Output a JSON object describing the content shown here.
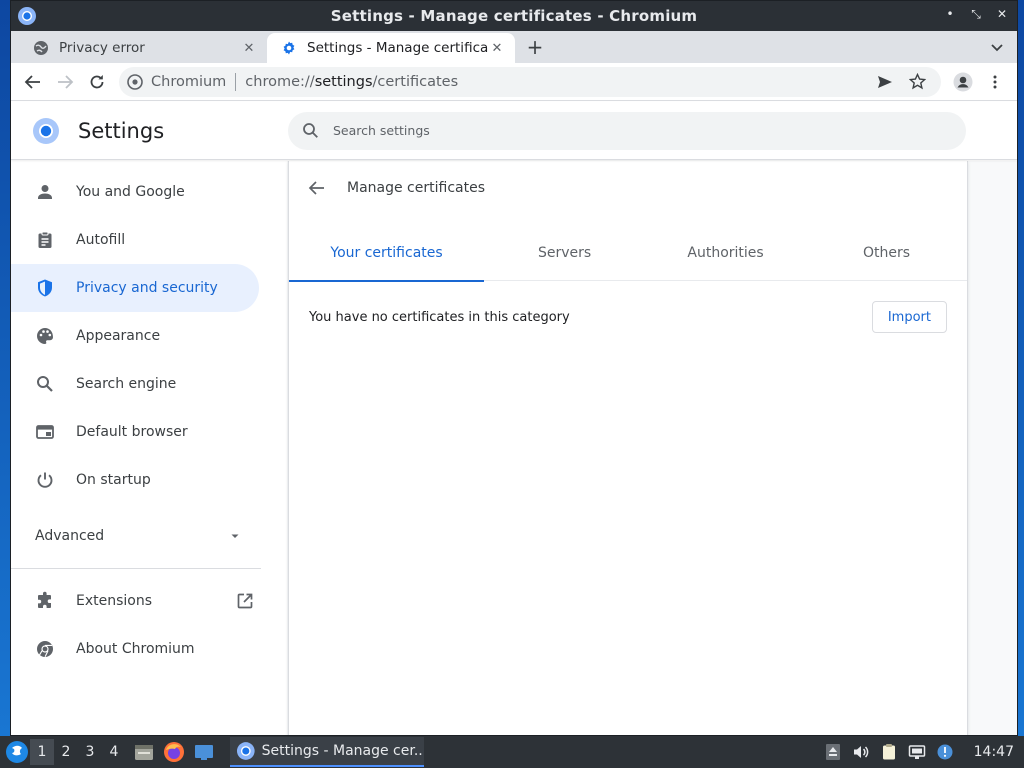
{
  "window": {
    "title": "Settings - Manage certificates - Chromium",
    "controls": [
      "•",
      "⤡",
      "✕"
    ]
  },
  "tabs": [
    {
      "label": "Privacy error",
      "icon": "globe-icon"
    },
    {
      "label": "Settings - Manage certifica",
      "icon": "gear-icon"
    }
  ],
  "toolbar": {
    "site_chip": "Chromium",
    "url_prefix": "chrome://",
    "url_host": "settings",
    "url_path": "/certificates"
  },
  "settings": {
    "title": "Settings",
    "search_placeholder": "Search settings"
  },
  "sidebar": {
    "items": [
      {
        "label": "You and Google",
        "icon": "person-icon"
      },
      {
        "label": "Autofill",
        "icon": "clipboard-icon"
      },
      {
        "label": "Privacy and security",
        "icon": "shield-icon"
      },
      {
        "label": "Appearance",
        "icon": "palette-icon"
      },
      {
        "label": "Search engine",
        "icon": "search-icon"
      },
      {
        "label": "Default browser",
        "icon": "browser-window-icon"
      },
      {
        "label": "On startup",
        "icon": "power-icon"
      }
    ],
    "advanced": "Advanced",
    "extensions": "Extensions",
    "about": "About Chromium"
  },
  "certificates": {
    "title": "Manage certificates",
    "tabs": [
      "Your certificates",
      "Servers",
      "Authorities",
      "Others"
    ],
    "empty_message": "You have no certificates in this category",
    "import_label": "Import"
  },
  "taskbar": {
    "workspaces": [
      "1",
      "2",
      "3",
      "4"
    ],
    "task_label": "Settings - Manage cer...",
    "clock": "14:47"
  },
  "colors": {
    "accent": "#1967d2",
    "active_nav_bg": "#e8f0fe",
    "titlebar": "#2b3036",
    "taskbar": "#2d3237"
  }
}
